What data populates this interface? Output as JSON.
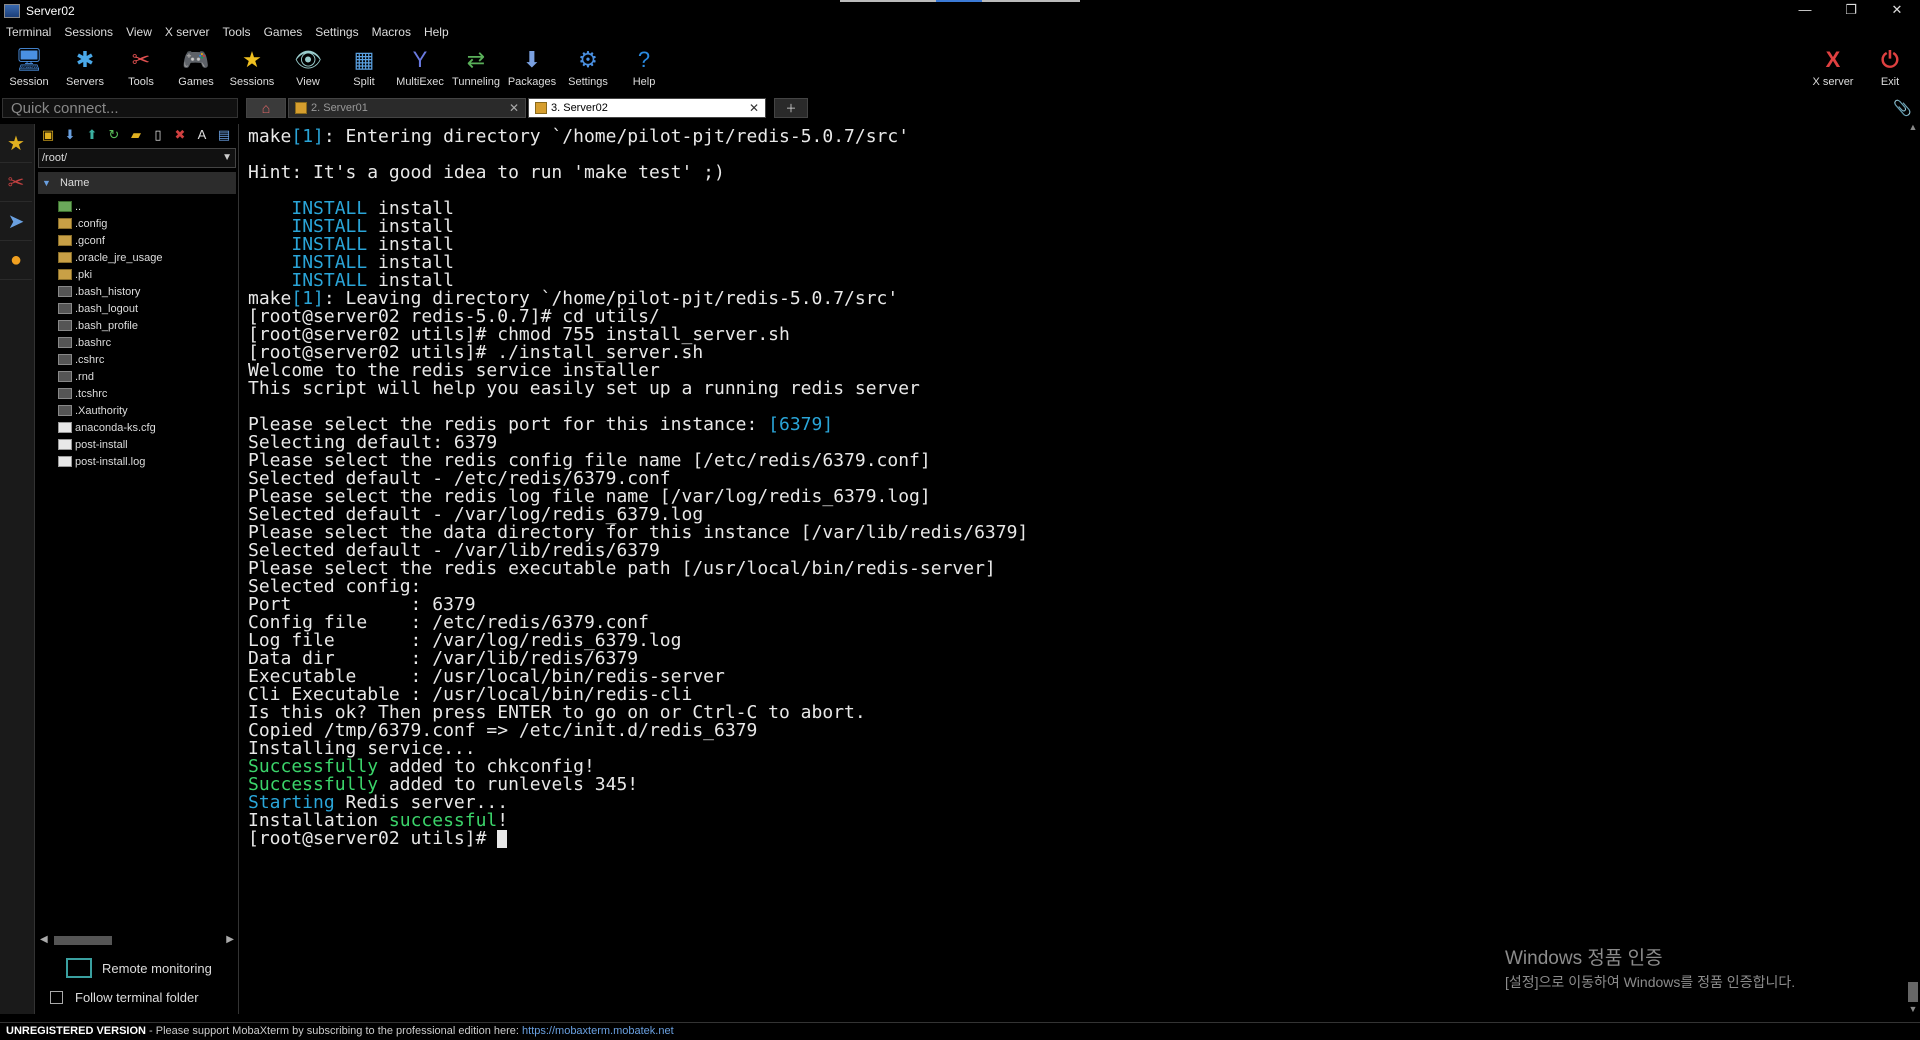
{
  "window": {
    "title": "Server02",
    "controls": [
      "—",
      "❐",
      "✕"
    ]
  },
  "menu": [
    "Terminal",
    "Sessions",
    "View",
    "X server",
    "Tools",
    "Games",
    "Settings",
    "Macros",
    "Help"
  ],
  "toolbar": [
    {
      "label": "Session",
      "icon": "session-icon",
      "glyph": "🖥",
      "color": "#4a90e2"
    },
    {
      "label": "Servers",
      "icon": "servers-icon",
      "glyph": "✱",
      "color": "#4aa8e8"
    },
    {
      "label": "Tools",
      "icon": "tools-icon",
      "glyph": "✂",
      "color": "#e05050"
    },
    {
      "label": "Games",
      "icon": "games-icon",
      "glyph": "🎮",
      "color": "#cccccc"
    },
    {
      "label": "Sessions",
      "icon": "star-icon",
      "glyph": "★",
      "color": "#f0c020"
    },
    {
      "label": "View",
      "icon": "view-icon",
      "glyph": "👁",
      "color": "#9cc"
    },
    {
      "label": "Split",
      "icon": "split-icon",
      "glyph": "▦",
      "color": "#5aa0e0"
    },
    {
      "label": "MultiExec",
      "icon": "multiexec-icon",
      "glyph": "Y",
      "color": "#6a7ae0"
    },
    {
      "label": "Tunneling",
      "icon": "tunneling-icon",
      "glyph": "⇄",
      "color": "#5ab05a"
    },
    {
      "label": "Packages",
      "icon": "packages-icon",
      "glyph": "⬇",
      "color": "#7aa0e0"
    },
    {
      "label": "Settings",
      "icon": "gear-icon",
      "glyph": "⚙",
      "color": "#4a90e2"
    },
    {
      "label": "Help",
      "icon": "help-icon",
      "glyph": "?",
      "color": "#2a8ae0"
    }
  ],
  "toolbar_right": [
    {
      "label": "X server",
      "icon": "xserver-icon",
      "glyph": "X",
      "color": "#e04040"
    },
    {
      "label": "Exit",
      "icon": "power-icon",
      "glyph": "⏻",
      "color": "#e04040"
    }
  ],
  "quick_connect": {
    "placeholder": "Quick connect..."
  },
  "tabs": [
    {
      "label": "2. Server01",
      "active": false
    },
    {
      "label": "3. Server02",
      "active": true
    }
  ],
  "sidebar": {
    "path": "/root/",
    "column": "Name",
    "files": [
      {
        "name": "..",
        "type": "up"
      },
      {
        "name": ".config",
        "type": "folder"
      },
      {
        "name": ".gconf",
        "type": "folder"
      },
      {
        "name": ".oracle_jre_usage",
        "type": "folder"
      },
      {
        "name": ".pki",
        "type": "folder"
      },
      {
        "name": ".bash_history",
        "type": "file"
      },
      {
        "name": ".bash_logout",
        "type": "file"
      },
      {
        "name": ".bash_profile",
        "type": "file"
      },
      {
        "name": ".bashrc",
        "type": "file"
      },
      {
        "name": ".cshrc",
        "type": "file"
      },
      {
        "name": ".rnd",
        "type": "file"
      },
      {
        "name": ".tcshrc",
        "type": "file"
      },
      {
        "name": ".Xauthority",
        "type": "file"
      },
      {
        "name": "anaconda-ks.cfg",
        "type": "doc"
      },
      {
        "name": "post-install",
        "type": "doc"
      },
      {
        "name": "post-install.log",
        "type": "doc"
      }
    ],
    "remote_monitoring": "Remote monitoring",
    "follow_terminal": "Follow terminal folder"
  },
  "terminal": {
    "lines": [
      [
        [
          "make",
          ""
        ],
        [
          "[1]",
          "cyan"
        ],
        [
          ": Entering directory `/home/pilot-pjt/redis-5.0.7/src'",
          ""
        ]
      ],
      [],
      [
        [
          "Hint: It's a good idea to run 'make test' ;)",
          ""
        ]
      ],
      [],
      [
        [
          "    ",
          ""
        ],
        [
          "INSTALL",
          "cyan"
        ],
        [
          " install",
          ""
        ]
      ],
      [
        [
          "    ",
          ""
        ],
        [
          "INSTALL",
          "cyan"
        ],
        [
          " install",
          ""
        ]
      ],
      [
        [
          "    ",
          ""
        ],
        [
          "INSTALL",
          "cyan"
        ],
        [
          " install",
          ""
        ]
      ],
      [
        [
          "    ",
          ""
        ],
        [
          "INSTALL",
          "cyan"
        ],
        [
          " install",
          ""
        ]
      ],
      [
        [
          "    ",
          ""
        ],
        [
          "INSTALL",
          "cyan"
        ],
        [
          " install",
          ""
        ]
      ],
      [
        [
          "make",
          ""
        ],
        [
          "[1]",
          "cyan"
        ],
        [
          ": Leaving directory `/home/pilot-pjt/redis-5.0.7/src'",
          ""
        ]
      ],
      [
        [
          "[root@server02 redis-5.0.7]# cd utils/",
          ""
        ]
      ],
      [
        [
          "[root@server02 utils]# chmod 755 install_server.sh",
          ""
        ]
      ],
      [
        [
          "[root@server02 utils]# ./install_server.sh",
          ""
        ]
      ],
      [
        [
          "Welcome to the redis service installer",
          ""
        ]
      ],
      [
        [
          "This script will help you easily set up a running redis server",
          ""
        ]
      ],
      [],
      [
        [
          "Please select the redis port for this instance: ",
          ""
        ],
        [
          "[6379]",
          "cyan"
        ]
      ],
      [
        [
          "Selecting default: 6379",
          ""
        ]
      ],
      [
        [
          "Please select the redis config file name [/etc/redis/6379.conf]",
          ""
        ]
      ],
      [
        [
          "Selected default - /etc/redis/6379.conf",
          ""
        ]
      ],
      [
        [
          "Please select the redis log file name [/var/log/redis_6379.log]",
          ""
        ]
      ],
      [
        [
          "Selected default - /var/log/redis_6379.log",
          ""
        ]
      ],
      [
        [
          "Please select the data directory for this instance [/var/lib/redis/6379]",
          ""
        ]
      ],
      [
        [
          "Selected default - /var/lib/redis/6379",
          ""
        ]
      ],
      [
        [
          "Please select the redis executable path [/usr/local/bin/redis-server]",
          ""
        ]
      ],
      [
        [
          "Selected config:",
          ""
        ]
      ],
      [
        [
          "Port           : 6379",
          ""
        ]
      ],
      [
        [
          "Config file    : /etc/redis/6379.conf",
          ""
        ]
      ],
      [
        [
          "Log file       : /var/log/redis_6379.log",
          ""
        ]
      ],
      [
        [
          "Data dir       : /var/lib/redis/6379",
          ""
        ]
      ],
      [
        [
          "Executable     : /usr/local/bin/redis-server",
          ""
        ]
      ],
      [
        [
          "Cli Executable : /usr/local/bin/redis-cli",
          ""
        ]
      ],
      [
        [
          "Is this ok? Then press ENTER to go on or Ctrl-C to abort.",
          ""
        ]
      ],
      [
        [
          "Copied /tmp/6379.conf => /etc/init.d/redis_6379",
          ""
        ]
      ],
      [
        [
          "Installing service...",
          ""
        ]
      ],
      [
        [
          "Successfully",
          "green"
        ],
        [
          " added to chkconfig!",
          ""
        ]
      ],
      [
        [
          "Successfully",
          "green"
        ],
        [
          " added to runlevels 345!",
          ""
        ]
      ],
      [
        [
          "Starting",
          "cyan"
        ],
        [
          " Redis server...",
          ""
        ]
      ],
      [
        [
          "Installation ",
          ""
        ],
        [
          "successful",
          "green"
        ],
        [
          "!",
          ""
        ]
      ],
      [
        [
          "[root@server02 utils]# ",
          ""
        ]
      ]
    ]
  },
  "watermark": {
    "line1": "Windows 정품 인증",
    "line2": "[설정]으로 이동하여 Windows를 정품 인증합니다."
  },
  "status": {
    "unregistered": "UNREGISTERED VERSION",
    "message": "  -  Please support MobaXterm by subscribing to the professional edition here:  ",
    "link": "https://mobaxterm.mobatek.net"
  }
}
